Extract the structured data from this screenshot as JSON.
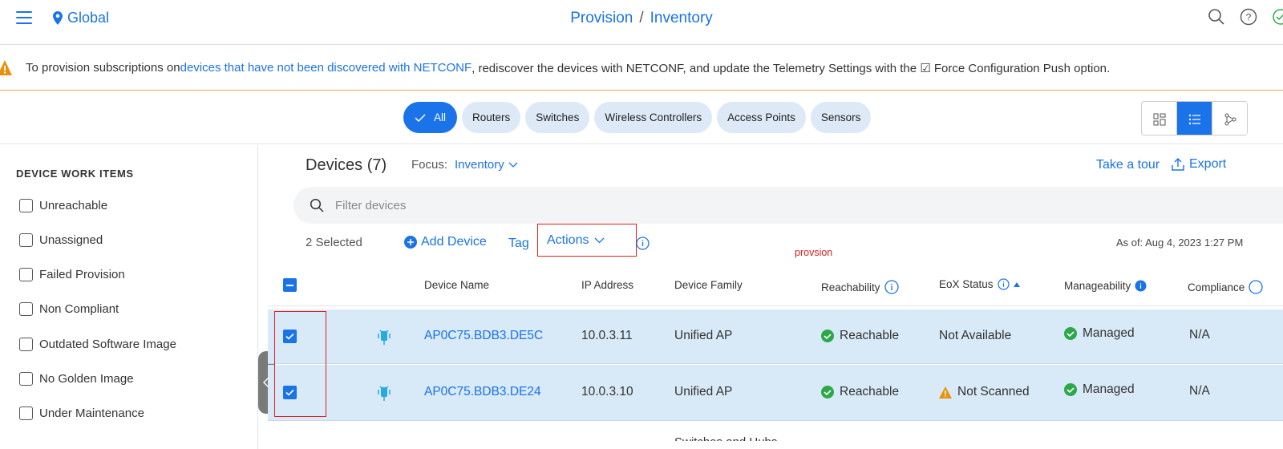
{
  "header": {
    "location": "Global",
    "breadcrumb": [
      "Provision",
      "Inventory"
    ],
    "breadcrumb_sep": "/"
  },
  "banner": {
    "text_before": "To provision subscriptions on ",
    "link": "devices that have not been discovered with NETCONF",
    "text_after": ", rediscover the devices with NETCONF, and update the Telemetry Settings with the ☑ Force Configuration Push option."
  },
  "filters": {
    "chips": [
      "All",
      "Routers",
      "Switches",
      "Wireless Controllers",
      "Access Points",
      "Sensors"
    ],
    "active": "All"
  },
  "sidebar": {
    "title": "DEVICE WORK ITEMS",
    "items": [
      "Unreachable",
      "Unassigned",
      "Failed Provision",
      "Non Compliant",
      "Outdated Software Image",
      "No Golden Image",
      "Under Maintenance"
    ]
  },
  "toolbar": {
    "devices_title": "Devices (7)",
    "focus_label": "Focus:",
    "focus_value": "Inventory",
    "take_tour": "Take a tour",
    "export": "Export",
    "search_placeholder": "Filter devices",
    "selected": "2 Selected",
    "add_device": "Add Device",
    "tag": "Tag",
    "actions": "Actions",
    "as_of": "As of: Aug 4, 2023 1:27 PM",
    "annotation": "provsion"
  },
  "table": {
    "columns": [
      "Device Name",
      "IP Address",
      "Device Family",
      "Reachability",
      "EoX Status",
      "Manageability",
      "Compliance"
    ],
    "rows": [
      {
        "name": "AP0C75.BDB3.DE5C",
        "ip": "10.0.3.11",
        "family": "Unified AP",
        "reachability": "Reachable",
        "eox": "Not Available",
        "manageability": "Managed",
        "compliance": "N/A"
      },
      {
        "name": "AP0C75.BDB3.DE24",
        "ip": "10.0.3.10",
        "family": "Unified AP",
        "reachability": "Reachable",
        "eox": "Not Scanned",
        "manageability": "Managed",
        "compliance": "N/A"
      }
    ],
    "next_row_family_partial": "Switches and Hubs"
  },
  "colors": {
    "accent": "#1a73e8",
    "warning": "#e8920c",
    "success": "#2ca84a",
    "annotation_red": "#e0201e",
    "selected_row": "#d8e9f7"
  },
  "icons": [
    "menu-icon",
    "location-pin-icon",
    "search-icon",
    "help-icon",
    "cloud-icon",
    "warning-icon",
    "check-icon",
    "grid-view-icon",
    "list-view-icon",
    "topology-view-icon",
    "chevron-left-icon",
    "chevron-down-icon",
    "export-icon",
    "plus-circle-icon",
    "info-icon",
    "access-point-icon",
    "reachable-check-icon",
    "managed-check-icon",
    "sort-up-icon"
  ]
}
